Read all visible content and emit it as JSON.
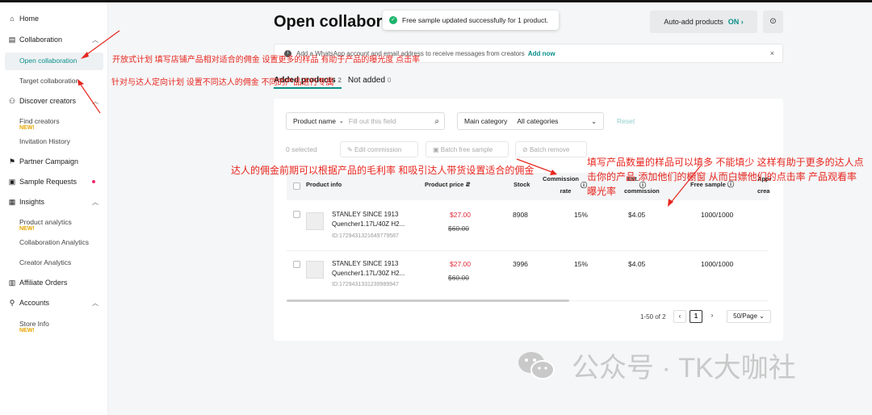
{
  "sidebar": {
    "home": "Home",
    "collaboration": "Collaboration",
    "open_collaboration": "Open collaboration",
    "target_collaboration": "Target collaboration",
    "discover_creators": "Discover creators",
    "find_creators": "Find creators",
    "new_badge": "NEW!",
    "invitation_history": "Invitation History",
    "partner_campaign": "Partner Campaign",
    "sample_requests": "Sample Requests",
    "insights": "Insights",
    "product_analytics": "Product analytics",
    "collaboration_analytics": "Collaboration Analytics",
    "creator_analytics": "Creator Analytics",
    "affiliate_orders": "Affiliate Orders",
    "accounts": "Accounts",
    "store_info": "Store Info"
  },
  "header": {
    "title": "Open collaborat",
    "toast": "Free sample updated successfully for 1 product.",
    "auto_add_label": "Auto-add products",
    "auto_add_state": "ON ›"
  },
  "banner": {
    "text": "Add a WhatsApp account and email address to receive messages from creators",
    "link": "Add now",
    "close": "×"
  },
  "tabs": [
    {
      "label": "Added products",
      "count": "2"
    },
    {
      "label": "Not added",
      "count": "0"
    }
  ],
  "filters": {
    "product_name_label": "Product name",
    "product_name_placeholder": "Fill out this field",
    "main_category_label": "Main category",
    "main_category_value": "All categories",
    "reset": "Reset"
  },
  "actions": {
    "selected": "0 selected",
    "edit_commission": "Edit commission",
    "batch_free_sample": "Batch free sample",
    "batch_remove": "Batch remove"
  },
  "table": {
    "headers": {
      "product_info": "Product info",
      "product_price": "Product price",
      "stock": "Stock",
      "commission_rate_1": "Commission",
      "commission_rate_2": "rate",
      "est_commission_1": "Est.",
      "est_commission_2": "commission",
      "free_sample": "Free sample",
      "approved_1": "Appr",
      "approved_2": "crea"
    },
    "rows": [
      {
        "name": "STANLEY SINCE 1913 Quencher1.17L/40Z H2...",
        "id": "ID:1729431321649779587",
        "price": "$27.00",
        "old_price": "$60.00",
        "stock": "8908",
        "commission_rate": "15%",
        "est_commission": "$4.05",
        "free_sample": "1000/1000"
      },
      {
        "name": "STANLEY SINCE 1913 Quencher1.17L/30Z H2...",
        "id": "ID:1729431331239989947",
        "price": "$27.00",
        "old_price": "$60.00",
        "stock": "3996",
        "commission_rate": "15%",
        "est_commission": "$4.05",
        "free_sample": "1000/1000"
      }
    ]
  },
  "pagination": {
    "range": "1-50 of 2",
    "prev": "‹",
    "page": "1",
    "next": "›",
    "per_page": "50/Page ⌄"
  },
  "annotations": {
    "open_note": "开放式计划 填写店铺产品相对适合的佣金 设置更多的样品 有助于产品的曝光度 点击率",
    "target_note": "针对与达人定向计划 设置不同达人的佣金 不同的产品进行专属",
    "commission_note": "达人的佣金前期可以根据产品的毛利率 和吸引达人带货设置适合的佣金",
    "sample_note_1": "填写产品数量的样品可以填多 不能填少 这样有助于更多的达人点",
    "sample_note_2": "击你的产品 添加他们的橱窗 从而白嫖他们的点击率 产品观看率",
    "sample_note_3": "曝光率"
  },
  "watermark": "公众号 · TK大咖社",
  "colors": {
    "accent": "#0a8f8a",
    "annotation": "#e6261f",
    "price": "#e0293a",
    "new_badge": "#e6a600"
  }
}
